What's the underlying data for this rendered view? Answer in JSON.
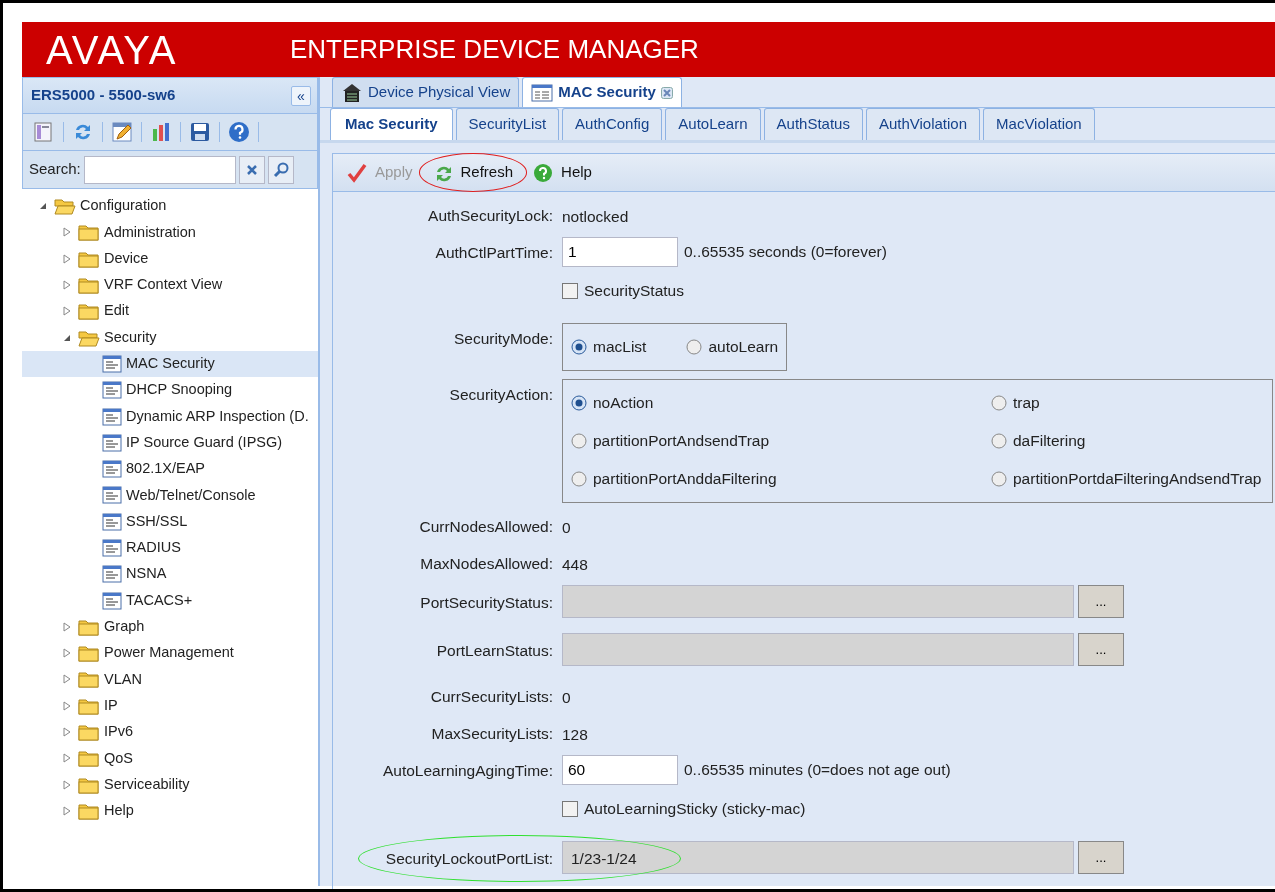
{
  "header": {
    "logo": "AVAYA",
    "title": "ENTERPRISE DEVICE MANAGER"
  },
  "sidebar": {
    "title": "ERS5000 - 5500-sw6",
    "collapse": "«",
    "search": {
      "label": "Search:"
    },
    "tree": [
      {
        "label": "Configuration",
        "kind": "folder",
        "expanded": true,
        "selected": false,
        "children": [
          {
            "label": "Administration",
            "kind": "folder",
            "expanded": false,
            "selected": false
          },
          {
            "label": "Device",
            "kind": "folder",
            "expanded": false,
            "selected": false
          },
          {
            "label": "VRF Context View",
            "kind": "folder",
            "expanded": false,
            "selected": false
          },
          {
            "label": "Edit",
            "kind": "folder",
            "expanded": false,
            "selected": false
          },
          {
            "label": "Security",
            "kind": "folder",
            "expanded": true,
            "selected": false,
            "children": [
              {
                "label": "MAC Security",
                "kind": "leaf",
                "selected": true
              },
              {
                "label": "DHCP Snooping",
                "kind": "leaf",
                "selected": false
              },
              {
                "label": "Dynamic ARP Inspection (D.",
                "kind": "leaf",
                "selected": false
              },
              {
                "label": "IP Source Guard (IPSG)",
                "kind": "leaf",
                "selected": false
              },
              {
                "label": "802.1X/EAP",
                "kind": "leaf",
                "selected": false
              },
              {
                "label": "Web/Telnet/Console",
                "kind": "leaf",
                "selected": false
              },
              {
                "label": "SSH/SSL",
                "kind": "leaf",
                "selected": false
              },
              {
                "label": "RADIUS",
                "kind": "leaf",
                "selected": false
              },
              {
                "label": "NSNA",
                "kind": "leaf",
                "selected": false
              },
              {
                "label": "TACACS+",
                "kind": "leaf",
                "selected": false
              }
            ]
          },
          {
            "label": "Graph",
            "kind": "folder",
            "expanded": false,
            "selected": false
          },
          {
            "label": "Power Management",
            "kind": "folder",
            "expanded": false,
            "selected": false
          },
          {
            "label": "VLAN",
            "kind": "folder",
            "expanded": false,
            "selected": false
          },
          {
            "label": "IP",
            "kind": "folder",
            "expanded": false,
            "selected": false
          },
          {
            "label": "IPv6",
            "kind": "folder",
            "expanded": false,
            "selected": false
          },
          {
            "label": "QoS",
            "kind": "folder",
            "expanded": false,
            "selected": false
          },
          {
            "label": "Serviceability",
            "kind": "folder",
            "expanded": false,
            "selected": false
          },
          {
            "label": "Help",
            "kind": "folder",
            "expanded": false,
            "selected": false
          }
        ]
      }
    ]
  },
  "doc_tabs": [
    {
      "label": "Device Physical View",
      "selected": false,
      "closable": false
    },
    {
      "label": "MAC Security",
      "selected": true,
      "closable": true
    }
  ],
  "sub_tabs": [
    {
      "label": "Mac Security",
      "selected": true
    },
    {
      "label": "SecurityList",
      "selected": false
    },
    {
      "label": "AuthConfig",
      "selected": false
    },
    {
      "label": "AutoLearn",
      "selected": false
    },
    {
      "label": "AuthStatus",
      "selected": false
    },
    {
      "label": "AuthViolation",
      "selected": false
    },
    {
      "label": "MacViolation",
      "selected": false
    }
  ],
  "toolbar": [
    {
      "label": "Apply",
      "kind": "apply",
      "disabled": true,
      "circled": false
    },
    {
      "label": "Refresh",
      "kind": "refresh",
      "disabled": false,
      "circled": true
    },
    {
      "label": "Help",
      "kind": "help",
      "disabled": false,
      "circled": false
    }
  ],
  "form": [
    {
      "kind": "text",
      "label": "AuthSecurityLock:",
      "value": "notlocked"
    },
    {
      "kind": "input",
      "label": "AuthCtlPartTime:",
      "value": "1",
      "hint": "0..65535 seconds (0=forever)"
    },
    {
      "kind": "checkbox",
      "label": "SecurityStatus",
      "checked": false
    },
    {
      "kind": "radio",
      "label": "SecurityMode:",
      "options": [
        {
          "label": "macList",
          "selected": true
        },
        {
          "label": "autoLearn",
          "selected": false
        }
      ]
    },
    {
      "kind": "radio",
      "label": "SecurityAction:",
      "options": [
        {
          "label": "noAction",
          "selected": true
        },
        {
          "label": "trap",
          "selected": false
        },
        {
          "label": "partitionPortAndsendTrap",
          "selected": false
        },
        {
          "label": "daFiltering",
          "selected": false
        },
        {
          "label": "partitionPortAnddaFiltering",
          "selected": false
        },
        {
          "label": "partitionPortdaFilteringAndsendTrap",
          "selected": false
        }
      ]
    },
    {
      "kind": "text",
      "label": "CurrNodesAllowed:",
      "value": "0"
    },
    {
      "kind": "text",
      "label": "MaxNodesAllowed:",
      "value": "448"
    },
    {
      "kind": "list",
      "label": "PortSecurityStatus:",
      "button": "...",
      "circled": false
    },
    {
      "kind": "list",
      "label": "PortLearnStatus:",
      "button": "...",
      "circled": false
    },
    {
      "kind": "text",
      "label": "CurrSecurityLists:",
      "value": "0"
    },
    {
      "kind": "text",
      "label": "MaxSecurityLists:",
      "value": "128"
    },
    {
      "kind": "input",
      "label": "AutoLearningAgingTime:",
      "value": "60",
      "hint": "0..65535 minutes (0=does not age out)"
    },
    {
      "kind": "checkbox",
      "label": "AutoLearningSticky (sticky-mac)",
      "checked": false
    },
    {
      "kind": "list",
      "label": "SecurityLockoutPortList:",
      "value": "1/23-1/24",
      "button": "...",
      "circled": true
    }
  ]
}
